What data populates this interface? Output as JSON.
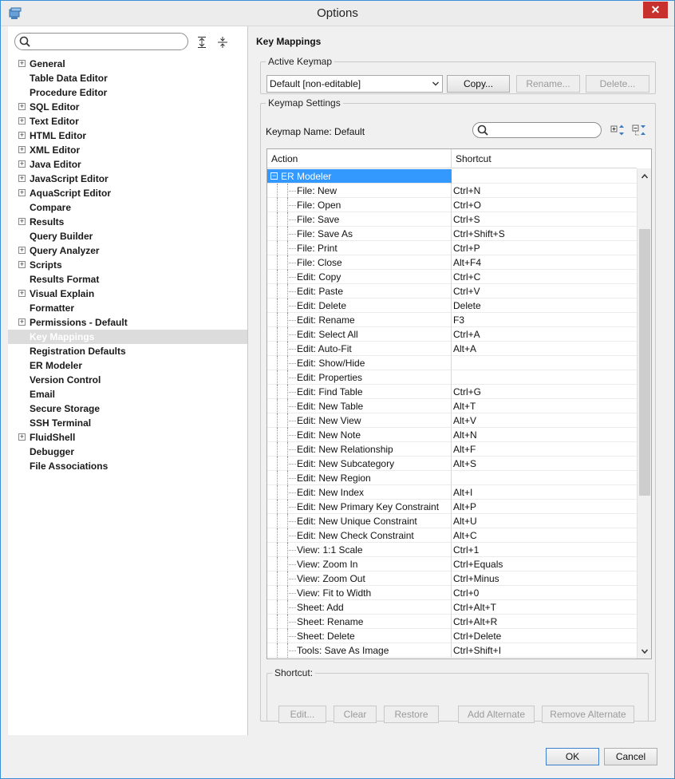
{
  "window": {
    "title": "Options",
    "close_glyph": "✕"
  },
  "sidebar": {
    "search_placeholder": "",
    "items": [
      {
        "label": "General",
        "expandable": true
      },
      {
        "label": "Table Data Editor",
        "expandable": false
      },
      {
        "label": "Procedure Editor",
        "expandable": false
      },
      {
        "label": "SQL Editor",
        "expandable": true
      },
      {
        "label": "Text Editor",
        "expandable": true
      },
      {
        "label": "HTML Editor",
        "expandable": true
      },
      {
        "label": "XML Editor",
        "expandable": true
      },
      {
        "label": "Java Editor",
        "expandable": true
      },
      {
        "label": "JavaScript Editor",
        "expandable": true
      },
      {
        "label": "AquaScript Editor",
        "expandable": true
      },
      {
        "label": "Compare",
        "expandable": false
      },
      {
        "label": "Results",
        "expandable": true
      },
      {
        "label": "Query Builder",
        "expandable": false
      },
      {
        "label": "Query Analyzer",
        "expandable": true
      },
      {
        "label": "Scripts",
        "expandable": true
      },
      {
        "label": "Results Format",
        "expandable": false
      },
      {
        "label": "Visual Explain",
        "expandable": true
      },
      {
        "label": "Formatter",
        "expandable": false
      },
      {
        "label": "Permissions - Default",
        "expandable": true
      },
      {
        "label": "Key Mappings",
        "expandable": false,
        "selected": true
      },
      {
        "label": "Registration Defaults",
        "expandable": false
      },
      {
        "label": "ER Modeler",
        "expandable": false
      },
      {
        "label": "Version Control",
        "expandable": false
      },
      {
        "label": "Email",
        "expandable": false
      },
      {
        "label": "Secure Storage",
        "expandable": false
      },
      {
        "label": "SSH Terminal",
        "expandable": false
      },
      {
        "label": "FluidShell",
        "expandable": true
      },
      {
        "label": "Debugger",
        "expandable": false
      },
      {
        "label": "File Associations",
        "expandable": false
      }
    ]
  },
  "main": {
    "title": "Key Mappings",
    "active_keymap": {
      "legend": "Active Keymap",
      "selected": "Default [non-editable]",
      "copy": "Copy...",
      "rename": "Rename...",
      "delete": "Delete..."
    },
    "keymap_settings": {
      "legend": "Keymap Settings",
      "name_label": "Keymap Name: Default",
      "search_placeholder": "",
      "columns": {
        "action": "Action",
        "shortcut": "Shortcut"
      },
      "group": {
        "label": "ER Modeler",
        "collapse_glyph": "−"
      },
      "rows": [
        {
          "action": "File: New",
          "shortcut": "Ctrl+N"
        },
        {
          "action": "File: Open",
          "shortcut": "Ctrl+O"
        },
        {
          "action": "File: Save",
          "shortcut": "Ctrl+S"
        },
        {
          "action": "File: Save As",
          "shortcut": "Ctrl+Shift+S"
        },
        {
          "action": "File: Print",
          "shortcut": "Ctrl+P"
        },
        {
          "action": "File: Close",
          "shortcut": "Alt+F4"
        },
        {
          "action": "Edit: Copy",
          "shortcut": "Ctrl+C"
        },
        {
          "action": "Edit: Paste",
          "shortcut": "Ctrl+V"
        },
        {
          "action": "Edit: Delete",
          "shortcut": "Delete"
        },
        {
          "action": "Edit: Rename",
          "shortcut": "F3"
        },
        {
          "action": "Edit: Select All",
          "shortcut": "Ctrl+A"
        },
        {
          "action": "Edit: Auto-Fit",
          "shortcut": "Alt+A"
        },
        {
          "action": "Edit: Show/Hide",
          "shortcut": ""
        },
        {
          "action": "Edit: Properties",
          "shortcut": ""
        },
        {
          "action": "Edit: Find Table",
          "shortcut": "Ctrl+G"
        },
        {
          "action": "Edit: New Table",
          "shortcut": "Alt+T"
        },
        {
          "action": "Edit: New View",
          "shortcut": "Alt+V"
        },
        {
          "action": "Edit: New Note",
          "shortcut": "Alt+N"
        },
        {
          "action": "Edit: New Relationship",
          "shortcut": "Alt+F"
        },
        {
          "action": "Edit: New Subcategory",
          "shortcut": "Alt+S"
        },
        {
          "action": "Edit: New Region",
          "shortcut": ""
        },
        {
          "action": "Edit: New Index",
          "shortcut": "Alt+I"
        },
        {
          "action": "Edit: New Primary Key Constraint",
          "shortcut": "Alt+P"
        },
        {
          "action": "Edit: New Unique Constraint",
          "shortcut": "Alt+U"
        },
        {
          "action": "Edit: New Check Constraint",
          "shortcut": "Alt+C"
        },
        {
          "action": "View: 1:1 Scale",
          "shortcut": "Ctrl+1"
        },
        {
          "action": "View: Zoom In",
          "shortcut": "Ctrl+Equals"
        },
        {
          "action": "View: Zoom Out",
          "shortcut": "Ctrl+Minus"
        },
        {
          "action": "View: Fit to Width",
          "shortcut": "Ctrl+0"
        },
        {
          "action": "Sheet: Add",
          "shortcut": "Ctrl+Alt+T"
        },
        {
          "action": "Sheet: Rename",
          "shortcut": "Ctrl+Alt+R"
        },
        {
          "action": "Sheet: Delete",
          "shortcut": "Ctrl+Delete"
        },
        {
          "action": "Tools: Save As Image",
          "shortcut": "Ctrl+Shift+I"
        }
      ]
    },
    "shortcut": {
      "legend": "Shortcut:",
      "edit": "Edit...",
      "clear": "Clear",
      "restore": "Restore",
      "add_alternate": "Add Alternate",
      "remove_alternate": "Remove Alternate"
    }
  },
  "footer": {
    "ok": "OK",
    "cancel": "Cancel"
  },
  "colors": {
    "selection": "#3399ff",
    "close": "#c7302c",
    "window_border": "#3c8ed8"
  }
}
